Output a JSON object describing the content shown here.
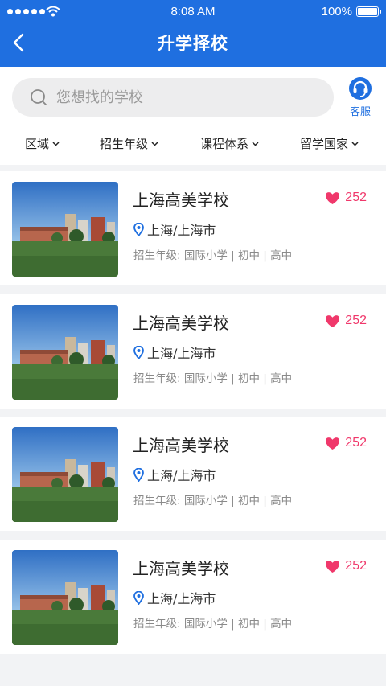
{
  "status_bar": {
    "time": "8:08 AM",
    "battery": "100%"
  },
  "nav": {
    "title": "升学择校"
  },
  "search": {
    "placeholder": "您想找的学校",
    "value": ""
  },
  "service": {
    "label": "客服"
  },
  "filters": [
    {
      "label": "区域"
    },
    {
      "label": "招生年级"
    },
    {
      "label": "课程体系"
    },
    {
      "label": "留学国家"
    }
  ],
  "schools": [
    {
      "name": "上海高美学校",
      "likes": "252",
      "location": "上海/上海市",
      "grades": "招生年级: 国际小学 | 初中 | 高中"
    },
    {
      "name": "上海高美学校",
      "likes": "252",
      "location": "上海/上海市",
      "grades": "招生年级: 国际小学 | 初中 | 高中"
    },
    {
      "name": "上海高美学校",
      "likes": "252",
      "location": "上海/上海市",
      "grades": "招生年级: 国际小学 | 初中 | 高中"
    },
    {
      "name": "上海高美学校",
      "likes": "252",
      "location": "上海/上海市",
      "grades": "招生年级: 国际小学 | 初中 | 高中"
    }
  ],
  "colors": {
    "primary": "#1f6fe0",
    "like": "#f0386b",
    "background": "#f2f3f5"
  },
  "icons": [
    "back-arrow-icon",
    "search-icon",
    "headset-icon",
    "chevron-down-icon",
    "heart-icon",
    "location-pin-icon"
  ]
}
